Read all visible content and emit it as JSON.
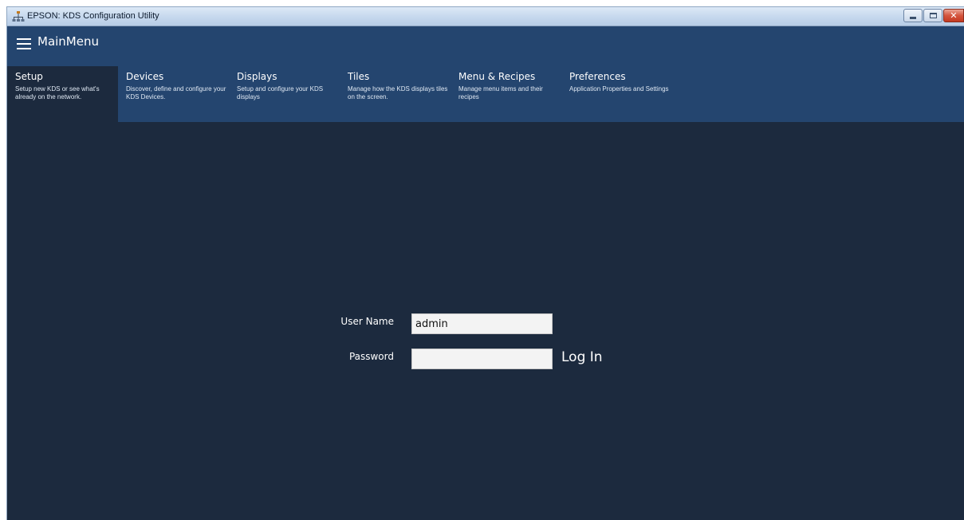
{
  "window": {
    "title": "EPSON: KDS Configuration Utility",
    "app_icon": "network-icon"
  },
  "header": {
    "menu_icon": "hamburger-menu-icon",
    "title": "MainMenu"
  },
  "nav": {
    "items": [
      {
        "title": "Setup",
        "description": "Setup new KDS or see what's already on the network.",
        "active": true
      },
      {
        "title": "Devices",
        "description": "Discover, define and configure your KDS Devices."
      },
      {
        "title": "Displays",
        "description": "Setup and configure your KDS displays"
      },
      {
        "title": "Tiles",
        "description": "Manage how the KDS displays tiles on the screen."
      },
      {
        "title": "Menu & Recipes",
        "description": "Manage menu items and their recipes"
      },
      {
        "title": "Preferences",
        "description": "Application Properties and Settings"
      }
    ]
  },
  "login": {
    "username_label": "User Name",
    "username_value": "admin",
    "password_label": "Password",
    "password_value": "",
    "login_label": "Log In"
  },
  "colors": {
    "background": "#1c2a3e",
    "header": "#24456f",
    "text": "#ffffff"
  }
}
